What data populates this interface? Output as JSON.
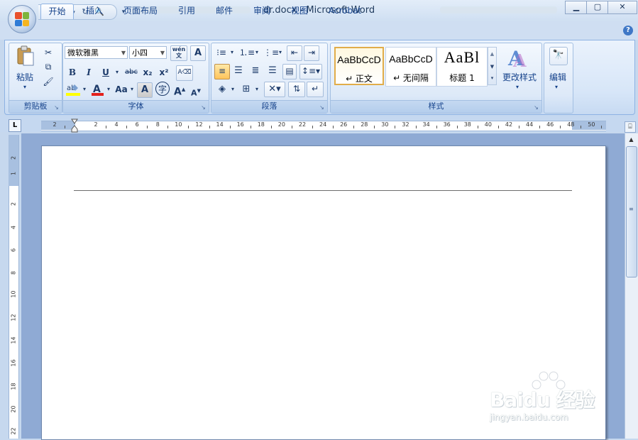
{
  "window": {
    "title": "dr.docx - Microsoft Word"
  },
  "tabs": [
    "开始",
    "插入",
    "页面布局",
    "引用",
    "邮件",
    "审阅",
    "视图",
    "Acrobat"
  ],
  "groups": {
    "clipboard": {
      "label": "剪贴板",
      "paste_label": "粘贴"
    },
    "font": {
      "label": "字体",
      "font_name": "微软雅黑",
      "font_size": "小四",
      "bold": "B",
      "italic": "I",
      "underline": "U",
      "strike": "abc",
      "sub": "x₂",
      "sup": "x²",
      "case": "Aa",
      "char_shade": "A",
      "enclose": "字",
      "grow": "A",
      "shrink": "A",
      "phonetic": "wén",
      "border": "A"
    },
    "paragraph": {
      "label": "段落"
    },
    "styles": {
      "label": "样式",
      "items": [
        {
          "sample": "AaBbCcD",
          "name": "↵ 正文"
        },
        {
          "sample": "AaBbCcD",
          "name": "↵ 无间隔"
        },
        {
          "sample": "AaBl",
          "name": "标题 1"
        }
      ],
      "change_label": "更改样式"
    },
    "editing": {
      "label": "编辑"
    }
  },
  "ruler": {
    "corner": "L",
    "h_numbers": [
      "2",
      "2",
      "4",
      "6",
      "8",
      "10",
      "12",
      "14",
      "16",
      "18",
      "20",
      "22",
      "24",
      "26",
      "28",
      "30",
      "32",
      "34",
      "36",
      "38",
      "40",
      "42",
      "44",
      "46",
      "48",
      "50"
    ],
    "v_numbers": [
      "2",
      "1",
      "2",
      "4",
      "6",
      "8",
      "10",
      "12",
      "14",
      "16",
      "18",
      "20",
      "22"
    ]
  },
  "watermark": {
    "brand": "Baidu 经验",
    "url": "jingyan.baidu.com"
  }
}
